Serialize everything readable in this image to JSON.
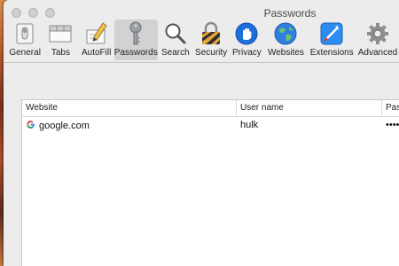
{
  "window": {
    "title": "Passwords"
  },
  "toolbar": {
    "items": [
      {
        "label": "General",
        "icon": "general-icon"
      },
      {
        "label": "Tabs",
        "icon": "tabs-icon"
      },
      {
        "label": "AutoFill",
        "icon": "autofill-icon"
      },
      {
        "label": "Passwords",
        "icon": "key-icon",
        "selected": true
      },
      {
        "label": "Search",
        "icon": "search-icon"
      },
      {
        "label": "Security",
        "icon": "lock-icon"
      },
      {
        "label": "Privacy",
        "icon": "hand-icon"
      },
      {
        "label": "Websites",
        "icon": "globe-icon"
      },
      {
        "label": "Extensions",
        "icon": "extensions-icon"
      },
      {
        "label": "Advanced",
        "icon": "gear-icon"
      }
    ]
  },
  "table": {
    "columns": [
      "Website",
      "User name",
      "Passw"
    ],
    "rows": [
      {
        "website": "google.com",
        "username": "hulk",
        "password": "••••••"
      }
    ]
  }
}
